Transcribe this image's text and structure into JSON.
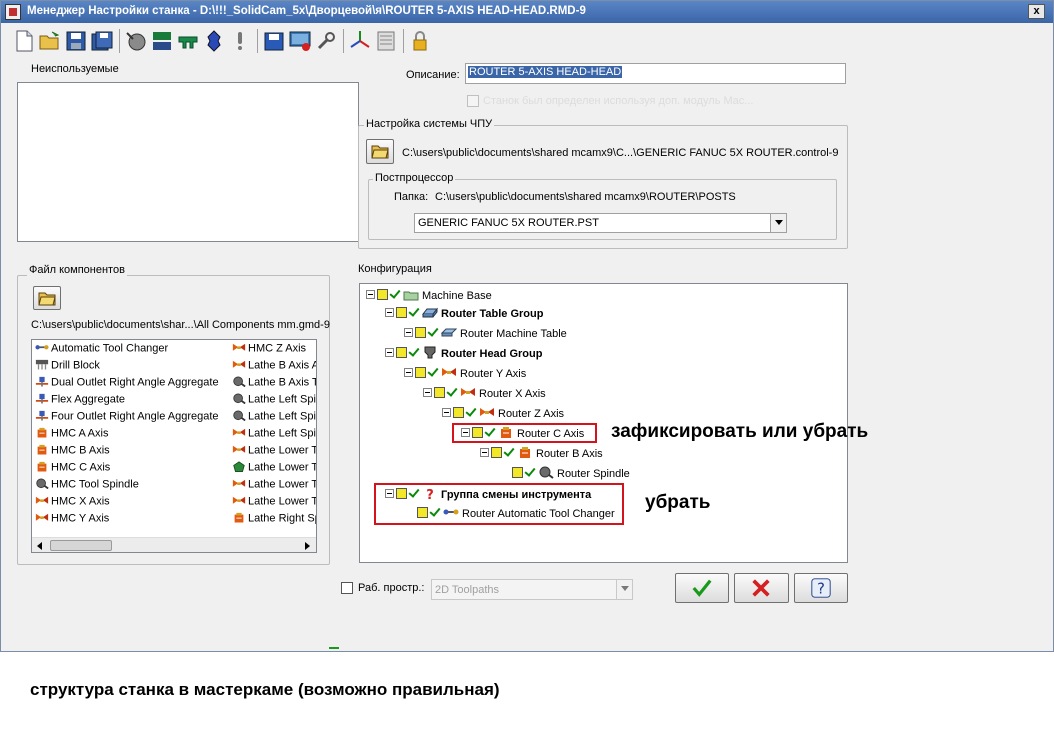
{
  "window": {
    "title": "Менеджер Настройки станка - D:\\!!!_SolidCam_5x\\Дворцевой\\я\\ROUTER 5-AXIS HEAD-HEAD.RMD-9",
    "close_label": "x"
  },
  "unused": {
    "label": "Неиспользуемые"
  },
  "description": {
    "label": "Описание:",
    "value": "ROUTER 5-AXIS HEAD-HEAD",
    "hidden_check_label": "Станок был определен используя доп. модуль Mac..."
  },
  "cnc_setup": {
    "group_label": "Настройка системы ЧПУ",
    "control_path": "C:\\users\\public\\documents\\shared mcamx9\\C...\\GENERIC FANUC 5X ROUTER.control-9",
    "post": {
      "group_label": "Постпроцессор",
      "folder_label": "Папка:",
      "folder_path": "C:\\users\\public\\documents\\shared mcamx9\\ROUTER\\POSTS",
      "selected": "GENERIC FANUC 5X ROUTER.PST"
    }
  },
  "components": {
    "group_label": "Файл компонентов",
    "path": "C:\\users\\public\\documents\\shar...\\All Components mm.gmd-9",
    "col1": [
      {
        "label": "Automatic Tool Changer",
        "icon": "tool-changer-icon"
      },
      {
        "label": "Drill Block",
        "icon": "drill-block-icon"
      },
      {
        "label": "Dual Outlet Right Angle Aggregate",
        "icon": "aggregate-icon"
      },
      {
        "label": "Flex Aggregate",
        "icon": "aggregate-icon"
      },
      {
        "label": "Four Outlet Right Angle Aggregate",
        "icon": "aggregate-icon"
      },
      {
        "label": "HMC A Axis",
        "icon": "rotary-axis-icon"
      },
      {
        "label": "HMC B Axis",
        "icon": "rotary-axis-icon"
      },
      {
        "label": "HMC C Axis",
        "icon": "rotary-axis-icon"
      },
      {
        "label": "HMC Tool Spindle",
        "icon": "spindle-icon"
      },
      {
        "label": "HMC X Axis",
        "icon": "linear-axis-icon"
      },
      {
        "label": "HMC Y Axis",
        "icon": "linear-axis-icon"
      }
    ],
    "col2": [
      {
        "label": "HMC Z Axis",
        "icon": "linear-axis-icon"
      },
      {
        "label": "Lathe B Axis A",
        "icon": "linear-axis-icon"
      },
      {
        "label": "Lathe B Axis T",
        "icon": "spindle-icon"
      },
      {
        "label": "Lathe Left Spi",
        "icon": "spindle-icon"
      },
      {
        "label": "Lathe Left Spi",
        "icon": "spindle-icon"
      },
      {
        "label": "Lathe Left Spi",
        "icon": "linear-axis-icon"
      },
      {
        "label": "Lathe Lower T",
        "icon": "linear-axis-icon"
      },
      {
        "label": "Lathe Lower T",
        "icon": "turret-icon"
      },
      {
        "label": "Lathe Lower T",
        "icon": "linear-axis-icon"
      },
      {
        "label": "Lathe Lower T",
        "icon": "linear-axis-icon"
      },
      {
        "label": "Lathe Right Sp",
        "icon": "rotary-axis-icon"
      }
    ]
  },
  "config": {
    "group_label": "Конфигурация",
    "nodes": [
      {
        "label": "Machine Base",
        "bold": false,
        "icon": "machine-base-icon"
      },
      {
        "label": "Router Table Group",
        "bold": true,
        "icon": "table-group-icon"
      },
      {
        "label": "Router Machine Table",
        "bold": false,
        "icon": "table-icon"
      },
      {
        "label": "Router Head Group",
        "bold": true,
        "icon": "head-group-icon"
      },
      {
        "label": "Router Y Axis",
        "bold": false,
        "icon": "linear-axis-icon"
      },
      {
        "label": "Router X Axis",
        "bold": false,
        "icon": "linear-axis-icon"
      },
      {
        "label": "Router Z Axis",
        "bold": false,
        "icon": "linear-axis-icon"
      },
      {
        "label": "Router C Axis",
        "bold": false,
        "icon": "rotary-axis-icon"
      },
      {
        "label": "Router B Axis",
        "bold": false,
        "icon": "rotary-axis-icon"
      },
      {
        "label": "Router Spindle",
        "bold": false,
        "icon": "spindle-icon"
      },
      {
        "label": "Группа смены инструмента",
        "bold": true,
        "icon": "question-icon"
      },
      {
        "label": "Router Automatic Tool Changer",
        "bold": false,
        "icon": "tool-changer-icon"
      }
    ]
  },
  "workspace": {
    "label": "Раб. простр.:",
    "value": "2D Toolpaths"
  },
  "annotations": {
    "fix_or_remove": "зафиксировать или убрать",
    "remove": "убрать",
    "caption": "структура станка в мастеркаме (возможно правильная)"
  },
  "colors": {
    "annotation_box": "#d4141c",
    "ok_green": "#1a9a1a",
    "cancel_red": "#d42020",
    "title_bar": "#3a66a8"
  }
}
